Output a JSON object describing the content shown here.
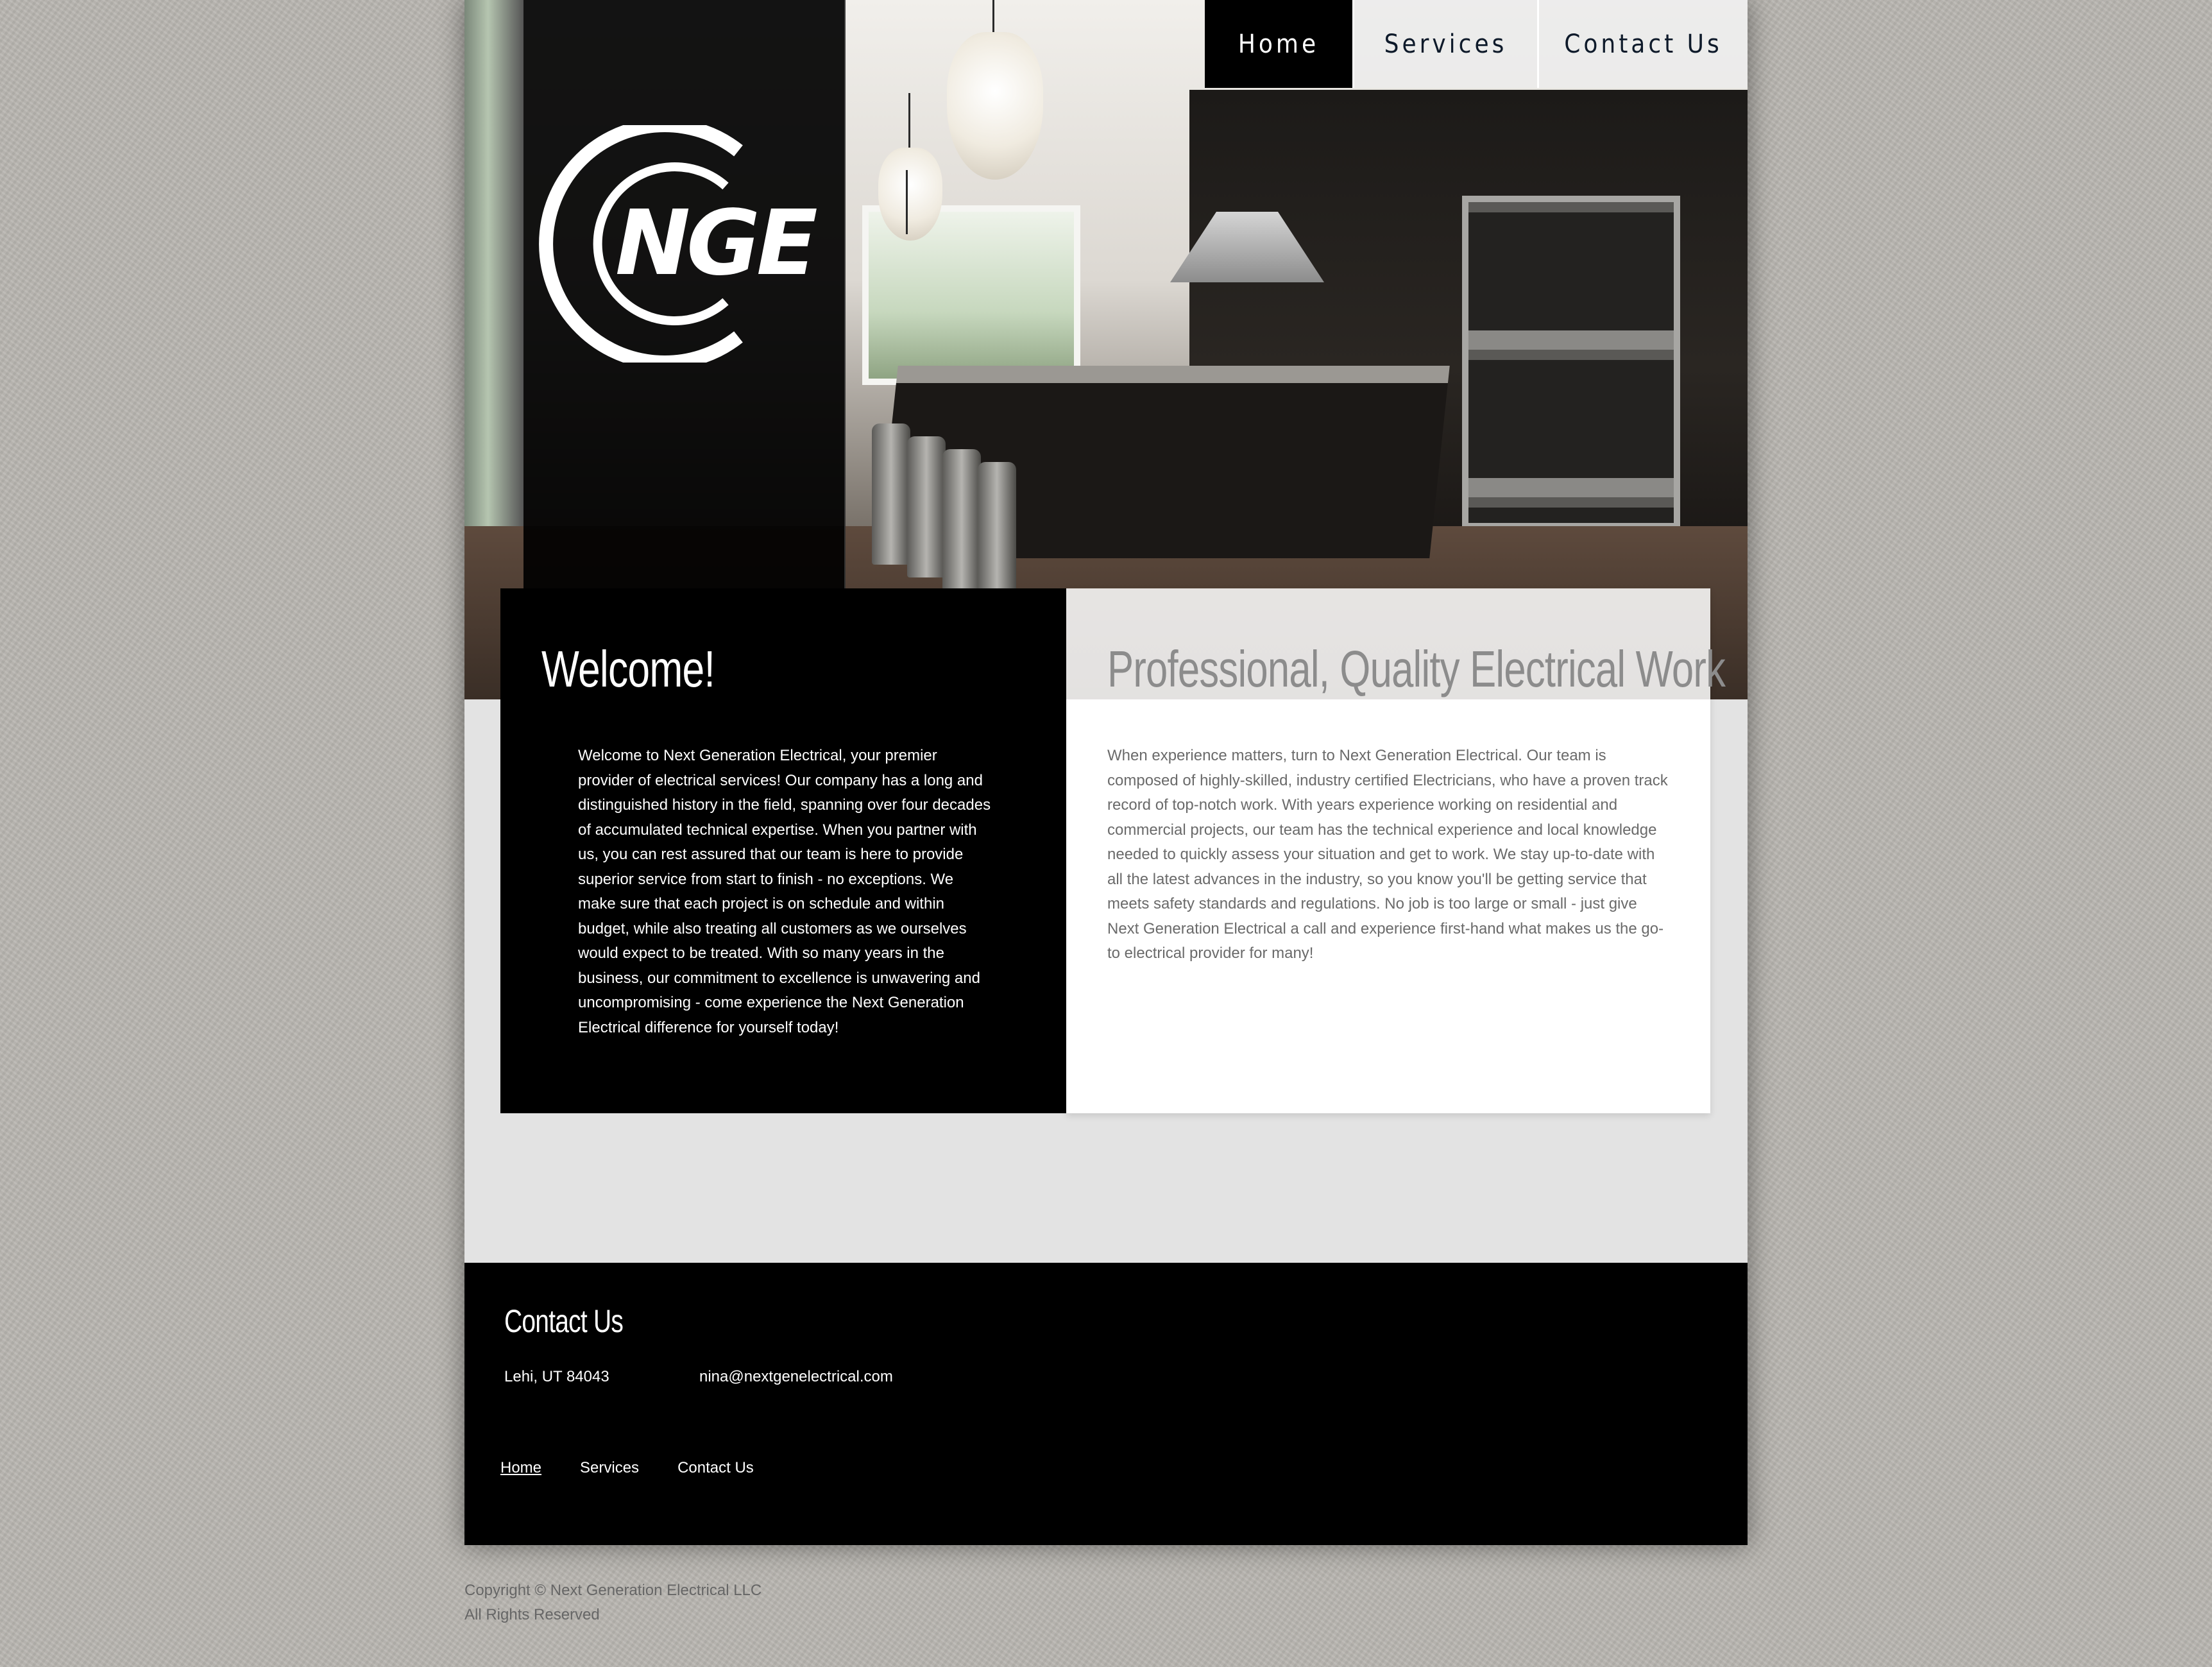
{
  "nav": {
    "items": [
      {
        "label": "Home",
        "active": true
      },
      {
        "label": "Services",
        "active": false
      },
      {
        "label": "Contact Us",
        "active": false
      }
    ]
  },
  "logo": {
    "text": "NGE",
    "alt": "NGE logo"
  },
  "welcome": {
    "title": "Welcome!",
    "body": "Welcome to Next Generation Electrical, your premier provider of electrical services! Our company has a long and distinguished history in the field, spanning over four decades of accumulated technical expertise. When you partner with us, you can rest assured that our team is here to provide superior service from start to finish - no exceptions. We make sure that each project is on schedule and within budget, while also treating all customers as we ourselves would expect to be treated. With so many years in the business, our commitment to excellence is unwavering and uncompromising - come experience the Next Generation Electrical difference for yourself today!"
  },
  "professional": {
    "title": "Professional, Quality Electrical Work",
    "body": "When experience matters, turn to Next Generation Electrical. Our team is composed of highly-skilled, industry certified Electricians, who have a proven track record of top-notch work. With years experience working on residential and commercial projects, our team has the technical experience and local knowledge needed to quickly assess your situation and get to work. We stay up-to-date with all the latest advances in the industry, so you know you'll be getting service that meets safety standards and regulations. No job is too large or small - just give Next Generation Electrical a call and experience first-hand what makes us the go-to electrical provider for many!"
  },
  "footer": {
    "title": "Contact Us",
    "city": "Lehi, UT 84043",
    "email": "nina@nextgenelectrical.com",
    "links": [
      {
        "label": "Home",
        "current": true
      },
      {
        "label": "Services",
        "current": false
      },
      {
        "label": "Contact Us",
        "current": false
      }
    ]
  },
  "copyright": {
    "line1": "Copyright © Next Generation Electrical LLC",
    "line2": "All Rights Reserved"
  },
  "colors": {
    "page_bg": "#b8b5b0",
    "nav_active_bg": "#000000",
    "nav_text": "#0e1a2a",
    "band_bg": "#e3e3e3",
    "heading_gray": "#8c8c8c",
    "body_gray": "#6a6a6a"
  }
}
